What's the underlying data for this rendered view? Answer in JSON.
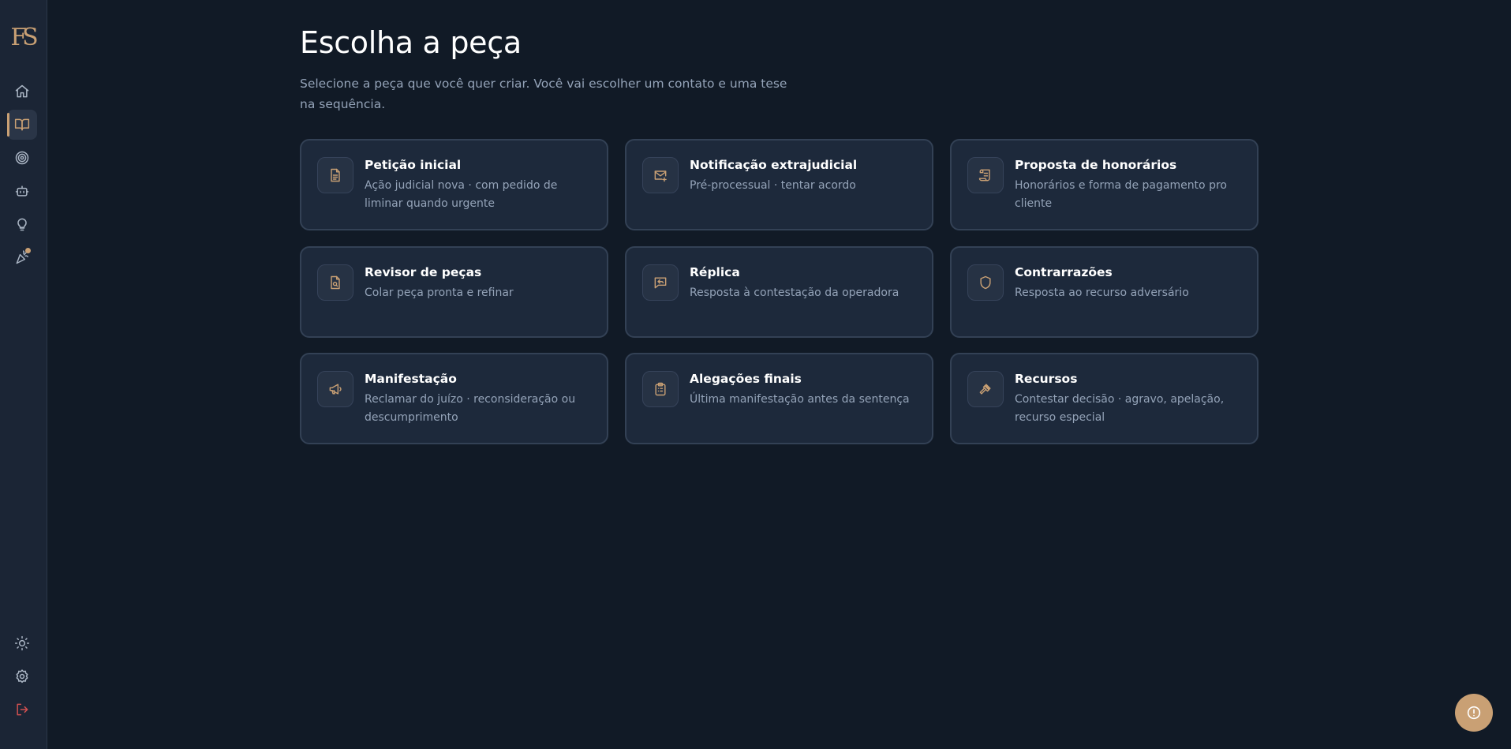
{
  "brand": {
    "logo_text": "FS"
  },
  "sidebar": {
    "top_items": [
      {
        "icon": "home-icon",
        "label": "Início"
      },
      {
        "icon": "book-open-icon",
        "label": "Peças",
        "active": true
      },
      {
        "icon": "target-icon",
        "label": "Metas"
      },
      {
        "icon": "bot-icon",
        "label": "Assistente"
      },
      {
        "icon": "lightbulb-icon",
        "label": "Ideias"
      },
      {
        "icon": "party-popper-icon",
        "label": "Novidades",
        "badge_dot": true
      }
    ],
    "bottom_items": [
      {
        "icon": "sun-icon",
        "label": "Tema"
      },
      {
        "icon": "gear-icon",
        "label": "Configurações"
      },
      {
        "icon": "logout-icon",
        "label": "Sair"
      }
    ]
  },
  "main": {
    "title": "Escolha a peça",
    "subtitle": "Selecione a peça que você quer criar. Você vai escolher um contato e uma tese na sequência."
  },
  "cards": [
    {
      "icon": "document-icon",
      "title": "Petição inicial",
      "description": "Ação judicial nova · com pedido de liminar quando urgente"
    },
    {
      "icon": "mail-icon",
      "title": "Notificação extrajudicial",
      "description": "Pré-processual · tentar acordo"
    },
    {
      "icon": "scroll-icon",
      "title": "Proposta de honorários",
      "description": "Honorários e forma de pagamento pro cliente"
    },
    {
      "icon": "file-search-icon",
      "title": "Revisor de peças",
      "description": "Colar peça pronta e refinar"
    },
    {
      "icon": "message-reply-icon",
      "title": "Réplica",
      "description": "Resposta à contestação da operadora"
    },
    {
      "icon": "shield-icon",
      "title": "Contrarrazões",
      "description": "Resposta ao recurso adversário"
    },
    {
      "icon": "megaphone-icon",
      "title": "Manifestação",
      "description": "Reclamar do juízo · reconsideração ou descumprimento"
    },
    {
      "icon": "clipboard-list-icon",
      "title": "Alegações finais",
      "description": "Última manifestação antes da sentença"
    },
    {
      "icon": "gavel-icon",
      "title": "Recursos",
      "description": "Contestar decisão · agravo, apelação, recurso especial"
    }
  ],
  "help_button": {
    "icon": "alert-circle-icon"
  },
  "colors": {
    "accent": "#c9a074",
    "background": "#111a26",
    "card": "#1d293b",
    "sidebar": "#1b2535",
    "danger": "#d05050"
  }
}
